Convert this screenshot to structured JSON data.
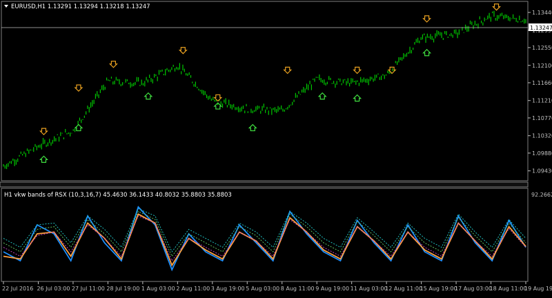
{
  "main_panel": {
    "title": "EURUSD,H1  1.13291 1.13294 1.13218 1.13247",
    "current_price": "1.13247",
    "price_ticks": [
      "1.13440",
      "1.12990",
      "1.12550",
      "1.12100",
      "1.11660",
      "1.11210",
      "1.10770",
      "1.10320",
      "1.09880",
      "1.09430"
    ]
  },
  "indicator_panel": {
    "title": "H1 vkw bands of RSX (10,3,16,7) 45.4630 36.1433 40.8032 35.8803 35.8803",
    "top_tick": "92.2662"
  },
  "time_axis": {
    "labels": [
      "22 Jul 2016",
      "26 Jul 03:00",
      "27 Jul 11:00",
      "28 Jul 19:00",
      "1 Aug 03:00",
      "2 Aug 11:00",
      "3 Aug 19:00",
      "5 Aug 03:00",
      "8 Aug 11:00",
      "9 Aug 19:00",
      "11 Aug 03:00",
      "12 Aug 11:00",
      "15 Aug 19:00",
      "17 Aug 03:00",
      "18 Aug 11:00",
      "19 Aug 19:00"
    ]
  },
  "colors": {
    "background": "#000000",
    "grid": "#3a3a3a",
    "axis": "#c0c0c0",
    "candles": "#00c800",
    "down_arrow": "#e8a020",
    "up_arrow": "#40e040",
    "price_line": "#c0c0c0",
    "rsx_fast": "#1e90ff",
    "rsx_slow": "#ffa040",
    "band_cyan": "#20c0c0",
    "band_green": "#60c060",
    "band_magenta": "#c040c0"
  },
  "chart_data": {
    "type": "line",
    "price_series": {
      "x": [
        "22 Jul 2016",
        "26 Jul 03:00",
        "27 Jul 11:00",
        "28 Jul 19:00",
        "1 Aug 03:00",
        "2 Aug 11:00",
        "3 Aug 19:00",
        "5 Aug 03:00",
        "8 Aug 11:00",
        "9 Aug 19:00",
        "11 Aug 03:00",
        "12 Aug 11:00",
        "15 Aug 19:00",
        "17 Aug 03:00",
        "18 Aug 11:00",
        "19 Aug 19:00"
      ],
      "values": [
        1.0955,
        1.1005,
        1.1045,
        1.117,
        1.1165,
        1.121,
        1.112,
        1.11,
        1.1095,
        1.1175,
        1.1165,
        1.1185,
        1.128,
        1.129,
        1.1335,
        1.1325
      ],
      "ylim": [
        1.0925,
        1.1365
      ]
    },
    "signals_down": [
      [
        "26 Jul 03:00",
        1.104
      ],
      [
        "27 Jul 11:00",
        1.115
      ],
      [
        "28 Jul 19:00",
        1.121
      ],
      [
        "2 Aug 11:00",
        1.1245
      ],
      [
        "3 Aug 19:00",
        1.1125
      ],
      [
        "8 Aug 11:00",
        1.1195
      ],
      [
        "11 Aug 03:00",
        1.1195
      ],
      [
        "12 Aug 11:00",
        1.1195
      ],
      [
        "15 Aug 19:00",
        1.1325
      ],
      [
        "18 Aug 11:00",
        1.1355
      ]
    ],
    "signals_up": [
      [
        "26 Jul 03:00",
        1.0975
      ],
      [
        "27 Jul 11:00",
        1.1055
      ],
      [
        "1 Aug 03:00",
        1.1135
      ],
      [
        "3 Aug 19:00",
        1.111
      ],
      [
        "5 Aug 03:00",
        1.1055
      ],
      [
        "9 Aug 19:00",
        1.1135
      ],
      [
        "11 Aug 03:00",
        1.113
      ],
      [
        "15 Aug 19:00",
        1.1245
      ]
    ],
    "indicator_series": [
      {
        "values": [
          40,
          30,
          70,
          60,
          30,
          80,
          50,
          30,
          90,
          70,
          20,
          60,
          40,
          30,
          70,
          50,
          30,
          85,
          60,
          40,
          30,
          75,
          50,
          30,
          70,
          40,
          30,
          80,
          50,
          30,
          75,
          45
        ]
      },
      {
        "values": [
          35,
          32,
          60,
          62,
          35,
          72,
          55,
          32,
          82,
          72,
          25,
          55,
          42,
          32,
          62,
          52,
          32,
          78,
          62,
          42,
          32,
          68,
          52,
          32,
          62,
          42,
          32,
          72,
          52,
          32,
          68,
          46
        ]
      },
      {
        "values": [
          55,
          45,
          70,
          72,
          50,
          80,
          65,
          45,
          88,
          80,
          40,
          65,
          55,
          45,
          72,
          62,
          45,
          85,
          72,
          55,
          45,
          78,
          62,
          45,
          72,
          55,
          45,
          82,
          62,
          45,
          76,
          55
        ]
      },
      {
        "values": [
          50,
          40,
          65,
          68,
          45,
          76,
          60,
          40,
          85,
          76,
          35,
          60,
          50,
          40,
          68,
          58,
          40,
          82,
          68,
          50,
          40,
          74,
          58,
          40,
          68,
          50,
          40,
          78,
          58,
          40,
          72,
          50
        ]
      },
      {
        "values": [
          45,
          35,
          58,
          62,
          40,
          70,
          55,
          35,
          80,
          72,
          30,
          55,
          45,
          35,
          62,
          52,
          35,
          76,
          62,
          45,
          35,
          68,
          52,
          35,
          62,
          45,
          35,
          72,
          52,
          35,
          66,
          45
        ]
      }
    ],
    "indicator_ylim": [
      10,
      100
    ]
  }
}
